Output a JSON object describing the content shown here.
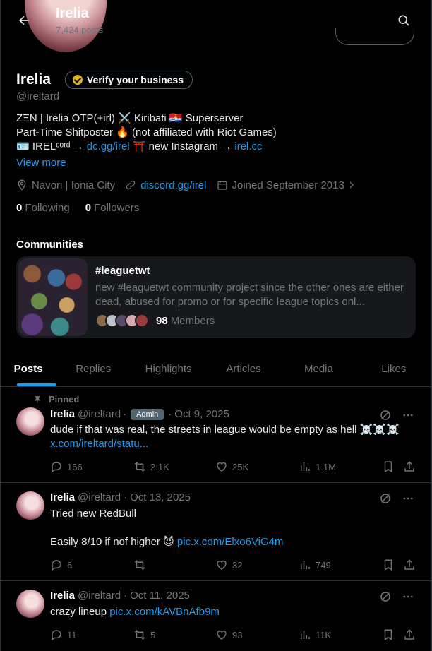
{
  "header": {
    "title": "Irelia",
    "posts_count": "7,424 posts"
  },
  "profile": {
    "display_name": "Irelia",
    "verify_label": "Verify your business",
    "handle": "@ireltard",
    "bio_line1": "ZΞN | Irelia OTP(+irl) ⚔️ Kiribati 🇰🇮 Superserver",
    "bio_line2": "Part-Time Shitposter 🔥 (not affiliated with Riot Games)",
    "bio_line3_prefix": "🪪 IRELᶜᵒʳᵈ → ",
    "bio_line3_link1": "dc.gg/irel",
    "bio_line3_mid": " ⛩️ new Instagram → ",
    "bio_line3_link2": "irel.cc",
    "view_more": "View more",
    "location": "Navori | Ionia City",
    "website": "discord.gg/irel",
    "joined": "Joined September 2013",
    "following_count": "0",
    "following_label": "Following",
    "followers_count": "0",
    "followers_label": "Followers"
  },
  "communities": {
    "heading": "Communities",
    "name": "#leaguetwt",
    "description": "new #leaguetwt community project since the other ones are either dead, abused for promo or for specific league topics onl...",
    "members_count": "98",
    "members_label": "Members"
  },
  "tabs": [
    "Posts",
    "Replies",
    "Highlights",
    "Articles",
    "Media",
    "Likes"
  ],
  "posts": [
    {
      "pinned_label": "Pinned",
      "name": "Irelia",
      "handle": "@ireltard",
      "admin_label": "Admin",
      "date": "Oct 9, 2025",
      "text_line1": "dude if that was real, the streets in league would be empty as hell ☠️☠️☠️",
      "text_link": "x.com/ireltard/statu...",
      "replies": "166",
      "reposts": "2.1K",
      "likes": "25K",
      "views": "1.1M"
    },
    {
      "name": "Irelia",
      "handle": "@ireltard",
      "date": "Oct 13, 2025",
      "text_line1": "Tried new RedBull",
      "text_line2": "Easily 8/10 if nof higher 😈 ",
      "text_link": "pic.x.com/Elxo6ViG4m",
      "replies": "6",
      "reposts": "",
      "likes": "32",
      "views": "749"
    },
    {
      "name": "Irelia",
      "handle": "@ireltard",
      "date": "Oct 11, 2025",
      "text_line1": "crazy lineup ",
      "text_link": "pic.x.com/kAVBnAfb9m",
      "replies": "11",
      "reposts": "5",
      "likes": "93",
      "views": "11K"
    }
  ],
  "colors": {
    "accent": "#1d9bf0",
    "muted": "#71767b",
    "background": "#000000",
    "verify_badge": "#e2b719"
  }
}
